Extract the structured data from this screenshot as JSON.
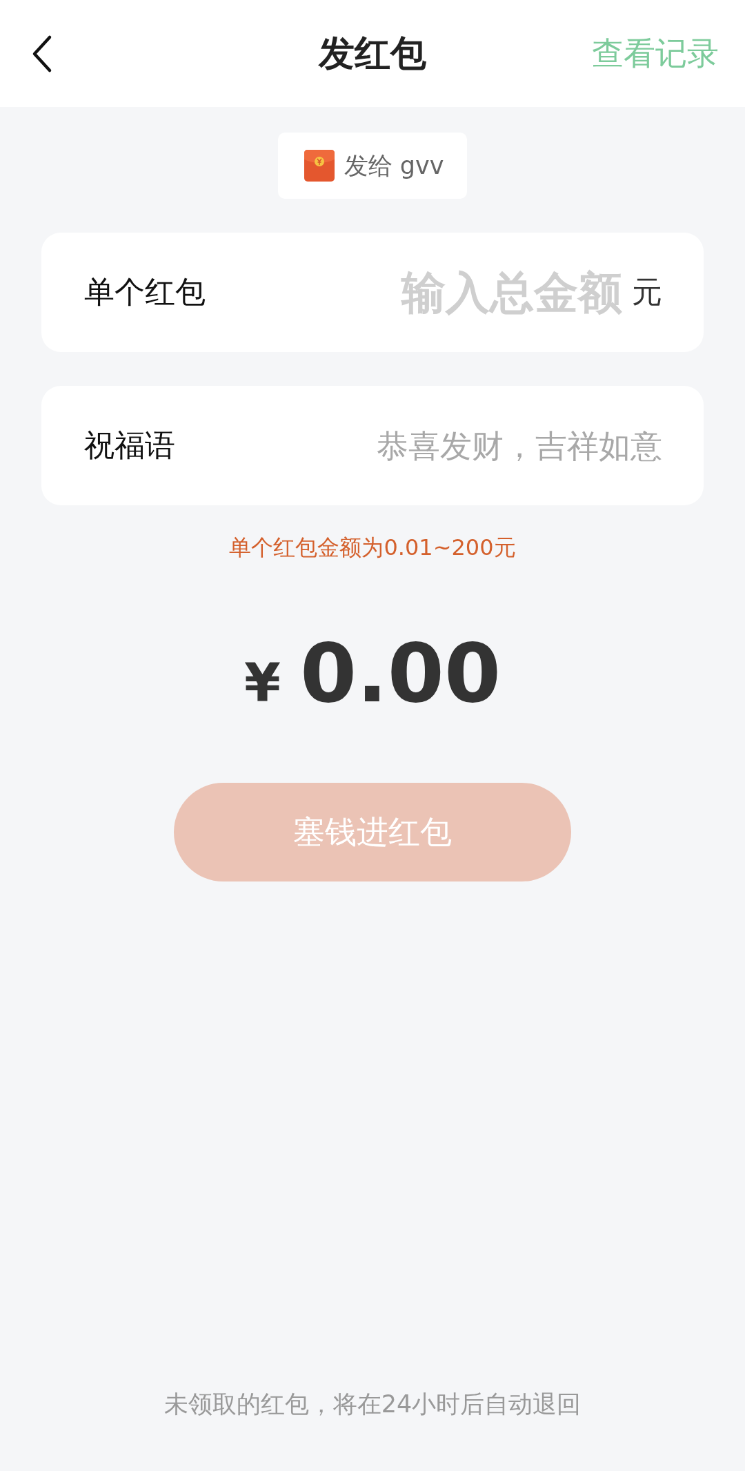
{
  "header": {
    "title": "发红包",
    "link": "查看记录"
  },
  "recipient": {
    "label": "发给 gvv"
  },
  "fields": [
    {
      "label": "单个红包",
      "placeholder": "输入总金额",
      "unit": "元",
      "kind": "amount"
    },
    {
      "label": "祝福语",
      "placeholder": "恭喜发财，吉祥如意",
      "kind": "text"
    }
  ],
  "hint": "单个红包金额为0.01~200元",
  "total": {
    "currency": "¥",
    "amount": "0.00"
  },
  "button": {
    "label": "塞钱进红包",
    "disabled": true
  },
  "footer": "未领取的红包，将在24小时后自动退回"
}
